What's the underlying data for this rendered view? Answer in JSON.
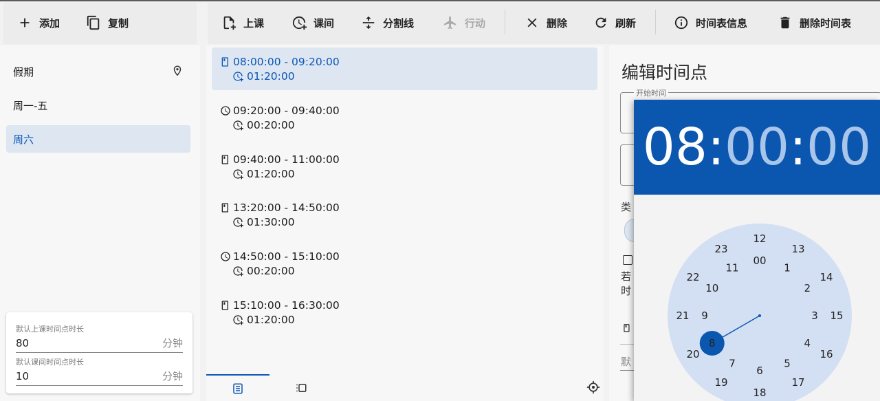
{
  "left_toolbar": {
    "add_label": "添加",
    "copy_label": "复制"
  },
  "main_toolbar": {
    "class_label": "上课",
    "break_label": "课间",
    "divider_label": "分割线",
    "action_label": "行动",
    "delete_label": "删除",
    "refresh_label": "刷新",
    "info_label": "时间表信息",
    "delete_timetable_label": "删除时间表"
  },
  "schedules": [
    {
      "label": "假期",
      "selected": false
    },
    {
      "label": "周一-五",
      "selected": false
    },
    {
      "label": "周六",
      "selected": true
    }
  ],
  "defaults": {
    "class_duration_label": "默认上课时间点时长",
    "class_duration_value": "80",
    "break_duration_label": "默认课间时间点时长",
    "break_duration_value": "10",
    "unit": "分钟"
  },
  "periods": [
    {
      "type": "class",
      "range": "08:00:00 - 09:20:00",
      "duration": "01:20:00",
      "selected": true
    },
    {
      "type": "break",
      "range": "09:20:00 - 09:40:00",
      "duration": "00:20:00",
      "selected": false
    },
    {
      "type": "class",
      "range": "09:40:00 - 11:00:00",
      "duration": "01:20:00",
      "selected": false
    },
    {
      "type": "class",
      "range": "13:20:00 - 14:50:00",
      "duration": "01:30:00",
      "selected": false
    },
    {
      "type": "break",
      "range": "14:50:00 - 15:10:00",
      "duration": "00:20:00",
      "selected": false
    },
    {
      "type": "class",
      "range": "15:10:00 - 16:30:00",
      "duration": "01:20:00",
      "selected": false
    }
  ],
  "editor": {
    "title": "编辑时间点",
    "start_time_label": "开始时间",
    "partial_type": "类",
    "partial_if": "若",
    "partial_time": "时",
    "partial_default": "默"
  },
  "time_picker": {
    "hour": "08",
    "minute": "00",
    "second": "00",
    "selected_hour": "8",
    "outer_ring": [
      "00",
      "13",
      "14",
      "3",
      "4",
      "5",
      "6",
      "7",
      "8",
      "9",
      "10",
      "11"
    ],
    "outer_ring_alt": [],
    "dial_outer": [
      "00",
      "1",
      "2",
      "3",
      "4",
      "5",
      "6",
      "7",
      "8",
      "9",
      "10",
      "11"
    ],
    "dial_inner": [
      "12",
      "13",
      "14",
      "15",
      "16",
      "17",
      "18",
      "19",
      "20",
      "21",
      "22",
      "23"
    ],
    "accent_color": "#0b57b0",
    "dial_color": "#d3dff3"
  },
  "colors": {
    "selected_bg": "#dde6f1",
    "selected_text": "#0b57b8"
  }
}
